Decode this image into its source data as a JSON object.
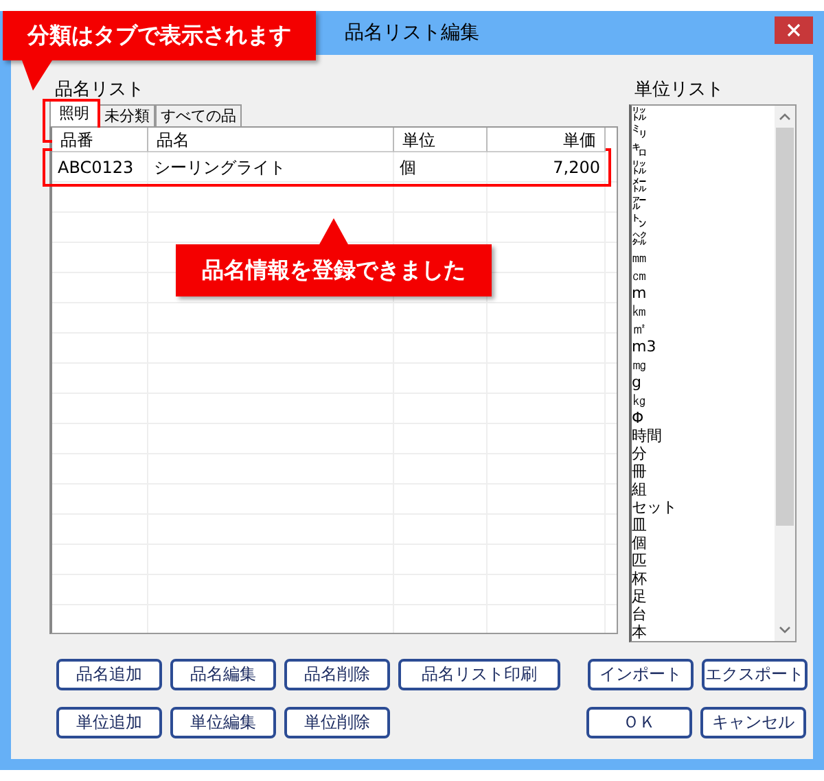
{
  "window": {
    "title": "品名リスト編集"
  },
  "callouts": [
    {
      "text": "分類はタブで表示されます"
    },
    {
      "text": "品名情報を登録できました"
    }
  ],
  "item_list": {
    "label": "品名リスト",
    "tabs": [
      {
        "label": "照明",
        "selected": true
      },
      {
        "label": "未分類",
        "selected": false
      },
      {
        "label": "すべての品",
        "selected": false
      }
    ],
    "columns": [
      "品番",
      "品名",
      "単位",
      "単価"
    ],
    "rows": [
      [
        "ABC0123",
        "シーリングライト",
        "個",
        "7,200"
      ]
    ]
  },
  "unit_list": {
    "label": "単位リスト",
    "items": [
      "㍑",
      "㍉",
      "㌔",
      "㍑",
      "㍍",
      "㌃",
      "㌧",
      "㌶",
      "㎜",
      "㎝",
      "m",
      "㎞",
      "㎡",
      "m3",
      "㎎",
      "g",
      "㎏",
      "Φ",
      "時間",
      "分",
      "冊",
      "組",
      "セット",
      "皿",
      "個",
      "匹",
      "杯",
      "足",
      "台",
      "本"
    ]
  },
  "buttons_row1": [
    "品名追加",
    "品名編集",
    "品名削除",
    "品名リスト印刷",
    "インポート",
    "エクスポート"
  ],
  "buttons_row2": [
    "単位追加",
    "単位編集",
    "単位削除",
    "ＯＫ",
    "キャンセル"
  ]
}
